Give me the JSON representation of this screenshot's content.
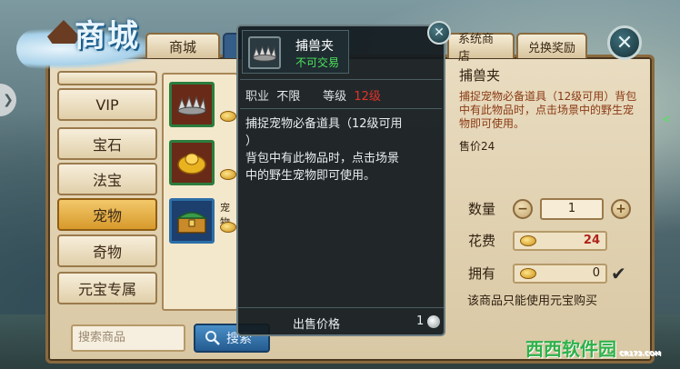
{
  "logo": {
    "title": "商城"
  },
  "tabs": {
    "shop": "商城",
    "system_shop": "系统商店",
    "exchange": "兑换奖励"
  },
  "close_glyph": "✕",
  "categories": [
    {
      "label": "VIP",
      "active": false
    },
    {
      "label": "宝石",
      "active": false
    },
    {
      "label": "法宝",
      "active": false
    },
    {
      "label": "宠物",
      "active": true
    },
    {
      "label": "奇物",
      "active": false
    },
    {
      "label": "元宝专属",
      "active": false
    }
  ],
  "items": [
    {
      "name": "",
      "icon": "trap-icon"
    },
    {
      "name": "",
      "icon": "gold-ingot-icon"
    },
    {
      "name": "宠物",
      "icon": "treasure-chest-icon"
    }
  ],
  "search": {
    "placeholder": "搜索商品",
    "button_label": "搜索"
  },
  "tooltip": {
    "item_name": "捕兽夹",
    "tradeable": "不可交易",
    "profession_label": "职业",
    "profession_value": "不限",
    "level_label": "等级",
    "level_value": "12级",
    "description_line1": "捕捉宠物必备道具（12级可用",
    "description_line2": "）",
    "description_line3": "背包中有此物品时，点击场景",
    "description_line4": "中的野生宠物即可使用。",
    "sell_price_label": "出售价格",
    "sell_price_value": "1"
  },
  "detail": {
    "name": "捕兽夹",
    "description": "捕捉宠物必备道具（12级可用）背包中有此物品时，点击场景中的野生宠物即可使用。",
    "price": "售价24",
    "quantity_label": "数量",
    "quantity_value": "1",
    "cost_label": "花费",
    "cost_value": "24",
    "owned_label": "拥有",
    "owned_value": "0",
    "note": "该商品只能使用元宝购买"
  },
  "watermark": {
    "text": "西西软件园",
    "url": "CR173.COM"
  },
  "colors": {
    "frame": "#d9c8a4",
    "active_tab": "#d79a2c",
    "tooltip_bg": "#121a1e",
    "green": "#4ee65c",
    "red": "#e0332a"
  }
}
